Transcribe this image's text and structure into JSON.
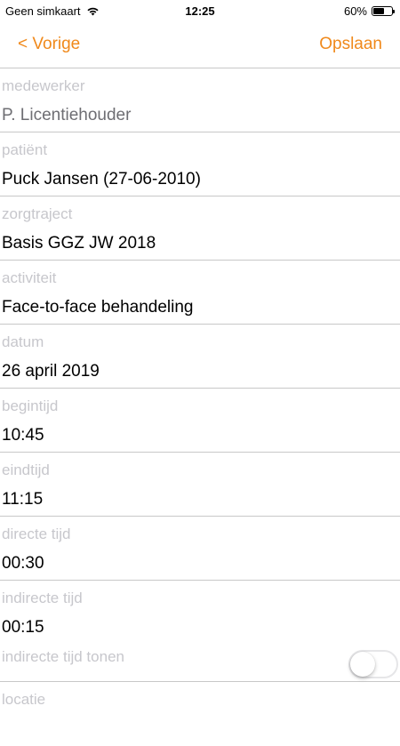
{
  "status_bar": {
    "carrier": "Geen simkaart",
    "time": "12:25",
    "battery_percent": "60%",
    "battery_level": 0.6,
    "wifi_icon": "wifi-icon"
  },
  "nav": {
    "back_label": "< Vorige",
    "save_label": "Opslaan"
  },
  "colors": {
    "accent": "#f0891b",
    "label": "#c7c7cc",
    "divider": "#c8c8c8"
  },
  "form": {
    "medewerker": {
      "label": "medewerker",
      "value": "P. Licentiehouder"
    },
    "patient": {
      "label": "patiënt",
      "value": "Puck Jansen (27-06-2010)"
    },
    "zorgtraject": {
      "label": "zorgtraject",
      "value": "Basis GGZ JW 2018"
    },
    "activiteit": {
      "label": "activiteit",
      "value": "Face-to-face behandeling"
    },
    "datum": {
      "label": "datum",
      "value": "26 april 2019"
    },
    "begintijd": {
      "label": "begintijd",
      "value": "10:45"
    },
    "eindtijd": {
      "label": "eindtijd",
      "value": "11:15"
    },
    "directe_tijd": {
      "label": "directe tijd",
      "value": "00:30"
    },
    "indirecte_tijd": {
      "label": "indirecte tijd",
      "value": "00:15"
    },
    "indirecte_tijd_tonen": {
      "label": "indirecte tijd tonen",
      "on": false
    },
    "locatie": {
      "label": "locatie"
    }
  }
}
